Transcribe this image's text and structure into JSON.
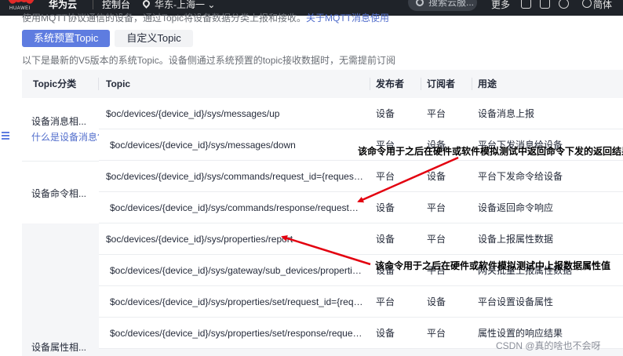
{
  "topbar": {
    "logo_text": "HUAWEI",
    "brand": "华为云",
    "console": "控制台",
    "region": "华东-上海一",
    "search_placeholder": "搜索云服...",
    "more": "更多",
    "lang": "简体"
  },
  "intro": {
    "text": "使用MQTT协议通信的设备，通过Topic将设备数据分类上报和接收。",
    "link": "关于MQTT消息使用"
  },
  "tabs": [
    {
      "label": "系统预置Topic",
      "active": true
    },
    {
      "label": "自定义Topic",
      "active": false
    }
  ],
  "description": "以下是最新的V5版本的系统Topic。设备侧通过系统预置的topic接收数据时，无需提前订阅",
  "table": {
    "headers": [
      "Topic分类",
      "Topic",
      "发布者",
      "订阅者",
      "用途"
    ],
    "groups": [
      {
        "label": "设备消息相...",
        "link": "什么是设备消息?",
        "rows": [
          {
            "topic": "$oc/devices/{device_id}/sys/messages/up",
            "publisher": "设备",
            "subscriber": "平台",
            "purpose": "设备消息上报"
          },
          {
            "topic": "$oc/devices/{device_id}/sys/messages/down",
            "publisher": "平台",
            "subscriber": "设备",
            "purpose": "平台下发消息给设备"
          }
        ]
      },
      {
        "label": "设备命令相...",
        "rows": [
          {
            "topic": "$oc/devices/{device_id}/sys/commands/request_id={request_id}",
            "publisher": "平台",
            "subscriber": "设备",
            "purpose": "平台下发命令给设备"
          },
          {
            "topic": "$oc/devices/{device_id}/sys/commands/response/request_id={request_id}",
            "publisher": "设备",
            "subscriber": "平台",
            "purpose": "设备返回命令响应"
          }
        ]
      },
      {
        "label": "设备属性相...",
        "rows": [
          {
            "topic": "$oc/devices/{device_id}/sys/properties/report",
            "publisher": "设备",
            "subscriber": "平台",
            "purpose": "设备上报属性数据"
          },
          {
            "topic": "$oc/devices/{device_id}/sys/gateway/sub_devices/properties/report",
            "publisher": "设备",
            "subscriber": "平台",
            "purpose": "网关批量上报属性数据"
          },
          {
            "topic": "$oc/devices/{device_id}/sys/properties/set/request_id={request_id}",
            "publisher": "平台",
            "subscriber": "设备",
            "purpose": "平台设置设备属性"
          },
          {
            "topic": "$oc/devices/{device_id}/sys/properties/set/response/request_id={request_id}",
            "publisher": "设备",
            "subscriber": "平台",
            "purpose": "属性设置的响应结果"
          }
        ]
      }
    ]
  },
  "annotations": {
    "commands": "该命令用于之后在硬件或软件模拟测试中返回命令下发的返回结果",
    "properties": "该命令用于之后在硬件或软件模拟测试中上报数据属性值"
  },
  "watermark": "CSDN @真的啥也不会呀",
  "colors": {
    "accent": "#5e7ce0",
    "link": "#526ecc",
    "annotation_arrow": "#e3000f",
    "topbar": "#1f2329"
  }
}
